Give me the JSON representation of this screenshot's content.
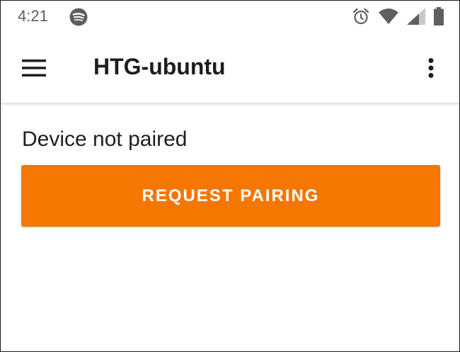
{
  "status_bar": {
    "time": "4:21",
    "icons": [
      "spotify-icon",
      "alarm-icon",
      "wifi-icon",
      "cellular-signal-icon",
      "battery-icon"
    ]
  },
  "app_bar": {
    "title": "HTG-ubuntu",
    "icons": [
      "hamburger-menu-icon",
      "overflow-menu-icon"
    ]
  },
  "main": {
    "status_text": "Device not paired",
    "request_pairing_label": "REQUEST PAIRING"
  },
  "colors": {
    "accent": "#f57600",
    "status_icon": "#5f5f5f",
    "text": "#1f1f1f",
    "background": "#ffffff"
  }
}
